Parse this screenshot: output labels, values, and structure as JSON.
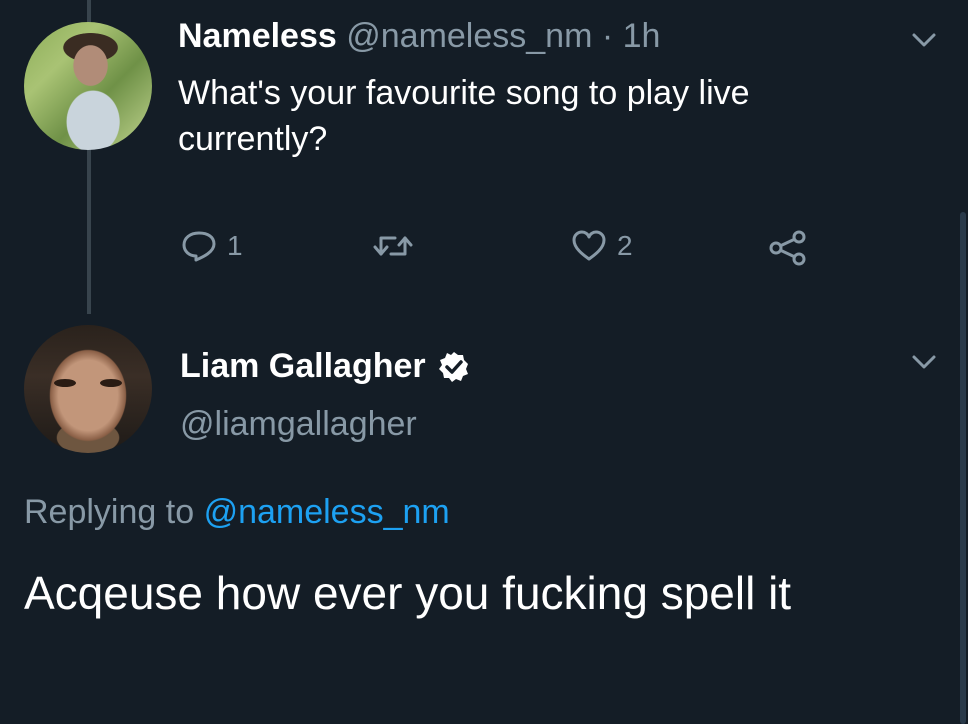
{
  "tweet1": {
    "author_name": "Nameless",
    "handle": "@nameless_nm",
    "separator": "·",
    "time": "1h",
    "text": "What's your favourite song to play live currently?",
    "reply_count": "1",
    "retweet_count": "",
    "like_count": "2"
  },
  "tweet2": {
    "author_name": "Liam Gallagher",
    "handle": "@liamgallagher",
    "replying_prefix": "Replying to",
    "replying_to": "@nameless_nm",
    "text": "Acqeuse how ever you fucking spell it"
  },
  "icons": {
    "menu": "chevron-down-icon",
    "reply": "reply-icon",
    "retweet": "retweet-icon",
    "like": "heart-icon",
    "share": "share-icon",
    "verified": "verified-badge-icon"
  },
  "colors": {
    "background": "#141d26",
    "muted": "#8899a6",
    "link": "#1da1f2",
    "thread_line": "#38444d",
    "text": "#ffffff"
  }
}
